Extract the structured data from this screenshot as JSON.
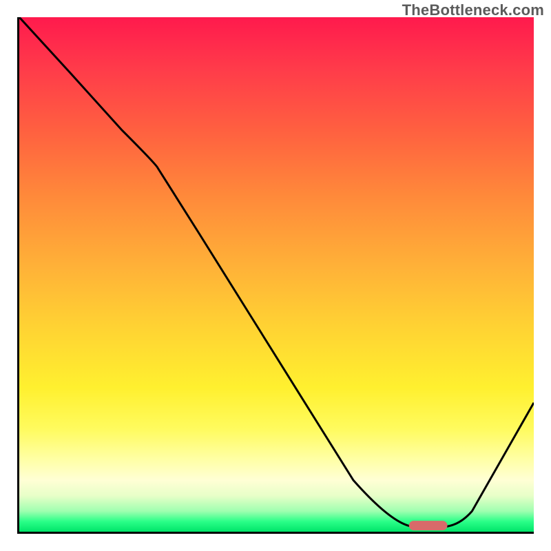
{
  "watermark": "TheBottleneck.com",
  "chart_data": {
    "type": "line",
    "title": "",
    "xlabel": "",
    "ylabel": "",
    "xlim": [
      0,
      100
    ],
    "ylim": [
      0,
      100
    ],
    "grid": false,
    "series": [
      {
        "name": "bottleneck-curve",
        "x": [
          0,
          10,
          20,
          27,
          35,
          45,
          55,
          65,
          72,
          76,
          82,
          88,
          100
        ],
        "y": [
          100,
          89,
          78,
          71,
          58,
          42,
          26,
          10,
          2,
          1,
          1,
          4,
          25
        ]
      }
    ],
    "marker": {
      "name": "optimal-range",
      "x_start": 76,
      "x_end": 83,
      "y": 1,
      "color": "#d86a6a"
    },
    "gradient_stops": [
      {
        "pos": 0,
        "color": "#ff1a4d"
      },
      {
        "pos": 50,
        "color": "#ffd233"
      },
      {
        "pos": 92,
        "color": "#ffffd5"
      },
      {
        "pos": 100,
        "color": "#00e56a"
      }
    ]
  }
}
